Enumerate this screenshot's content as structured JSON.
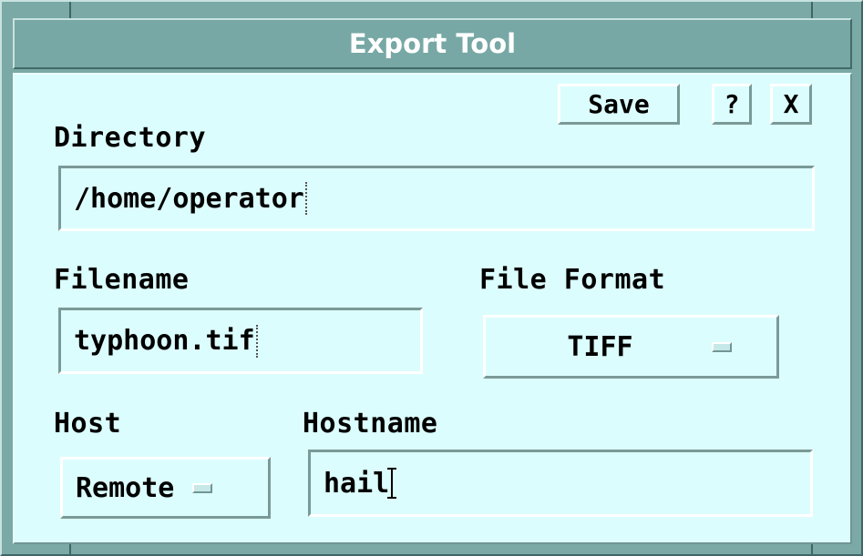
{
  "window": {
    "title": "Export Tool"
  },
  "toolbar": {
    "save_label": "Save",
    "help_label": "?",
    "close_label": "X"
  },
  "directory": {
    "label": "Directory",
    "value": "/home/operator"
  },
  "filename": {
    "label": "Filename",
    "value": "typhoon.tif"
  },
  "file_format": {
    "label": "File Format",
    "selected": "TIFF"
  },
  "host": {
    "label": "Host",
    "selected": "Remote"
  },
  "hostname": {
    "label": "Hostname",
    "value": "hail"
  },
  "colors": {
    "frame": "#7aa9a6",
    "client_background": "#dcfdfd",
    "title_text": "#ffffff"
  }
}
